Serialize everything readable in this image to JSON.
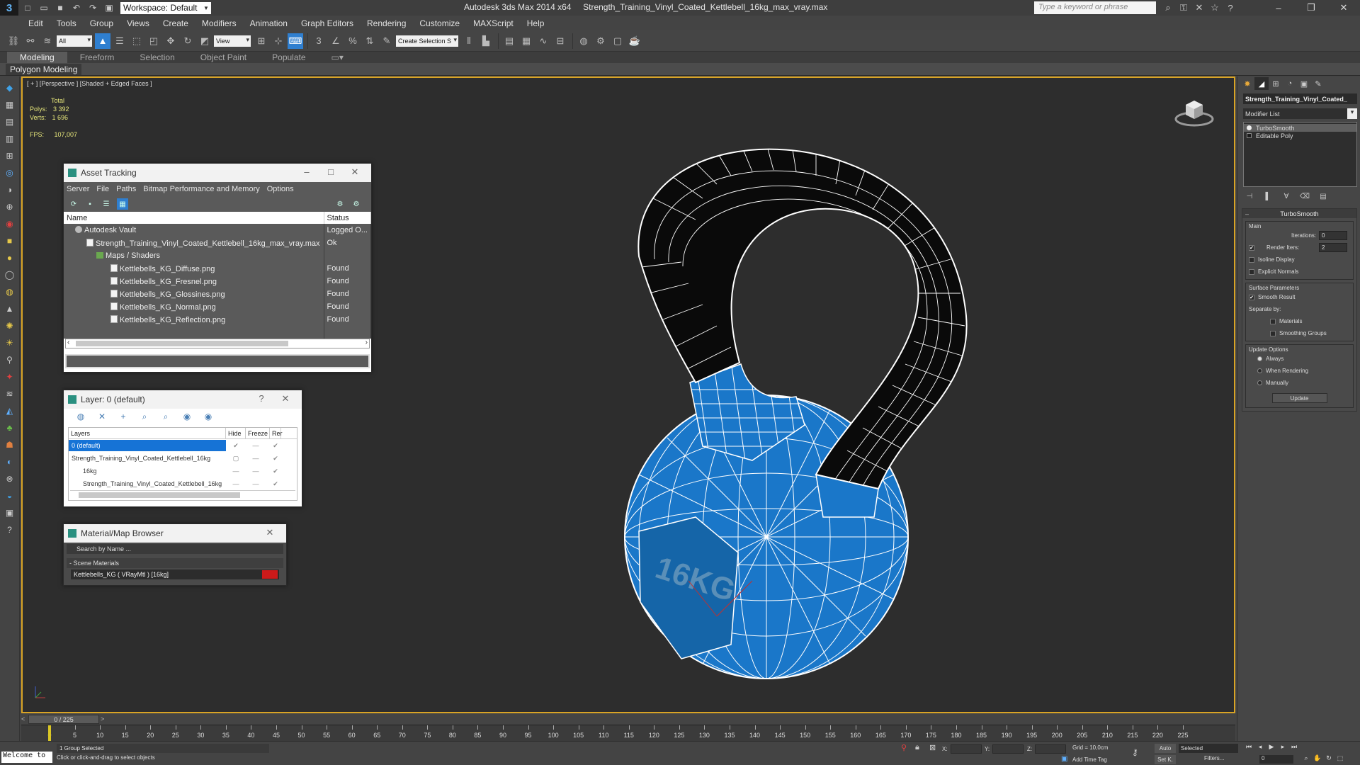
{
  "window": {
    "title": "Autodesk 3ds Max  2014 x64",
    "file_title": "Strength_Training_Vinyl_Coated_Kettlebell_16kg_max_vray.max",
    "workspace": "Workspace: Default",
    "search_placeholder": "Type a keyword or phrase"
  },
  "menu": [
    "Edit",
    "Tools",
    "Group",
    "Views",
    "Create",
    "Modifiers",
    "Animation",
    "Graph Editors",
    "Rendering",
    "Customize",
    "MAXScript",
    "Help"
  ],
  "toolbar": {
    "filter_value": "All",
    "refcoord_value": "View",
    "named_selection": "Create Selection S"
  },
  "ribbon": {
    "tabs": [
      "Modeling",
      "Freeform",
      "Selection",
      "Object Paint",
      "Populate"
    ],
    "active_tab": "Modeling",
    "panel": "Polygon Modeling"
  },
  "viewport": {
    "label": "[ + ] [Perspective ] [Shaded + Edged Faces ]",
    "stats_total": "Total",
    "polys_label": "Polys:",
    "polys_value": "3 392",
    "verts_label": "Verts:",
    "verts_value": "1 696",
    "fps_label": "FPS:",
    "fps_value": "107,007",
    "model_text": "16KG",
    "colors": {
      "background": "#2d2d2d",
      "body": "#1a77c9",
      "handle": "#0a0a0a",
      "wire": "#ffffff",
      "active_border": "#d9a425"
    }
  },
  "asset_tracking": {
    "title": "Asset Tracking",
    "menu": [
      "Server",
      "File",
      "Paths",
      "Bitmap Performance and Memory",
      "Options"
    ],
    "col_name": "Name",
    "col_status": "Status",
    "rows": [
      {
        "name": "Autodesk Vault",
        "status": "Logged O...",
        "icon": "vault-icon",
        "indent": 0
      },
      {
        "name": "Strength_Training_Vinyl_Coated_Kettlebell_16kg_max_vray.max",
        "status": "Ok",
        "icon": "file-icon",
        "indent": 1
      },
      {
        "name": "Maps / Shaders",
        "status": "",
        "icon": "folder-icon",
        "indent": 2
      },
      {
        "name": "Kettlebells_KG_Diffuse.png",
        "status": "Found",
        "icon": "image-file-icon",
        "indent": 3
      },
      {
        "name": "Kettlebells_KG_Fresnel.png",
        "status": "Found",
        "icon": "image-file-icon",
        "indent": 3
      },
      {
        "name": "Kettlebells_KG_Glossines.png",
        "status": "Found",
        "icon": "image-file-icon",
        "indent": 3
      },
      {
        "name": "Kettlebells_KG_Normal.png",
        "status": "Found",
        "icon": "image-file-icon",
        "indent": 3
      },
      {
        "name": "Kettlebells_KG_Reflection.png",
        "status": "Found",
        "icon": "image-file-icon",
        "indent": 3
      }
    ]
  },
  "layer_dialog": {
    "title": "Layer: 0 (default)",
    "help": "?",
    "columns": [
      "Layers",
      "Hide",
      "Freeze",
      "Rer"
    ],
    "rows": [
      {
        "name": "0 (default)",
        "selected": true
      },
      {
        "name": "Strength_Training_Vinyl_Coated_Kettlebell_16kg",
        "selected": false
      },
      {
        "name": "16kg",
        "selected": false
      },
      {
        "name": "Strength_Training_Vinyl_Coated_Kettlebell_16kg",
        "selected": false
      }
    ]
  },
  "material_browser": {
    "title": "Material/Map Browser",
    "search_placeholder": "Search by Name ...",
    "group": "- Scene Materials",
    "item": "Kettlebells_KG  ( VRayMtl ) [16kg]",
    "swatch_color": "#cc1a1a"
  },
  "command_panel": {
    "object_name": "Strength_Training_Vinyl_Coated_",
    "modifier_list": "Modifier List",
    "stack": [
      "TurboSmooth",
      "Editable Poly"
    ],
    "rollout_title": "TurboSmooth",
    "main_label": "Main",
    "iterations_label": "Iterations:",
    "iterations_value": "0",
    "render_iters_label": "Render Iters:",
    "render_iters_value": "2",
    "isoline_label": "Isoline Display",
    "explicit_normals_label": "Explicit Normals",
    "surface_params_label": "Surface Parameters",
    "smooth_result_label": "Smooth Result",
    "separate_by_label": "Separate by:",
    "materials_label": "Materials",
    "smoothing_groups_label": "Smoothing Groups",
    "update_options_label": "Update Options",
    "always_label": "Always",
    "when_rendering_label": "When Rendering",
    "manually_label": "Manually",
    "update_button": "Update"
  },
  "timeline": {
    "frame_display": "0 / 225",
    "ticks": [
      0,
      5,
      10,
      15,
      20,
      25,
      30,
      35,
      40,
      45,
      50,
      55,
      60,
      65,
      70,
      75,
      80,
      85,
      90,
      95,
      100,
      105,
      110,
      115,
      120,
      125,
      130,
      135,
      140,
      145,
      150,
      155,
      160,
      165,
      170,
      175,
      180,
      185,
      190,
      195,
      200,
      205,
      210,
      215,
      220,
      225
    ]
  },
  "status": {
    "maxscript": "Welcome to",
    "selection": "1 Group Selected",
    "prompt": "Click or click-and-drag to select objects",
    "x_label": "X:",
    "y_label": "Y:",
    "z_label": "Z:",
    "grid": "Grid = 10,0cm",
    "add_time_tag": "Add Time Tag",
    "auto_key": "Auto",
    "set_key": "Set K.",
    "selected_dropdown": "Selected",
    "filters": "Filters...",
    "current_frame": "0"
  }
}
